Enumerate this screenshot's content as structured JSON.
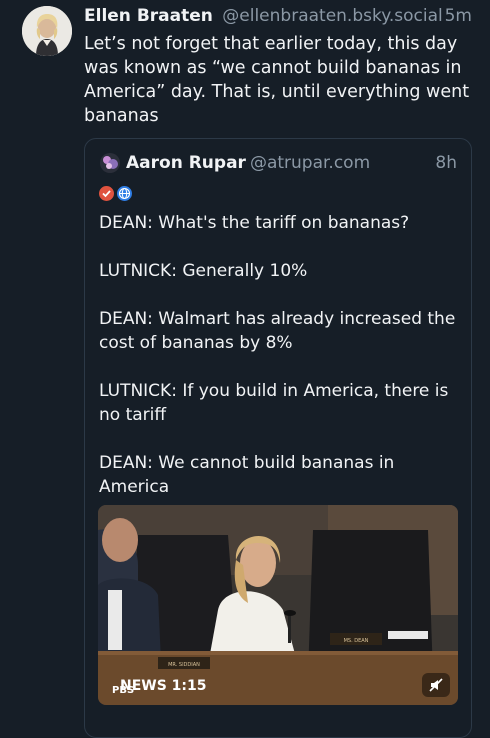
{
  "post": {
    "author_name": "Ellen Braaten",
    "author_handle": "@ellenbraaten.bsky.social",
    "time": "5m",
    "text": "Let’s not forget that earlier today, this day was known as “we cannot build bananas in America” day. That is, until everything went bananas"
  },
  "quote": {
    "author_name": "Aaron Rupar",
    "author_handle": "@atrupar.com",
    "time": "8h",
    "badges": [
      "verified-check-icon",
      "globe-icon"
    ],
    "paragraphs": [
      "DEAN: What's the tariff on bananas?",
      "LUTNICK: Generally 10%",
      "DEAN: Walmart has already increased the cost of bananas by 8%",
      "LUTNICK: If you build in America, there is no tariff",
      "DEAN: We cannot build bananas in America"
    ],
    "video": {
      "logo_top": "PBS",
      "logo_bottom": "N",
      "duration": "EWS 1:15",
      "nameplate_left": "MR. SIDDIAN",
      "nameplate_right": "MS. DEAN"
    }
  },
  "colors": {
    "background": "#161e27",
    "text": "#f1f3f5",
    "muted": "#8b98a5",
    "border": "#2c3947"
  }
}
